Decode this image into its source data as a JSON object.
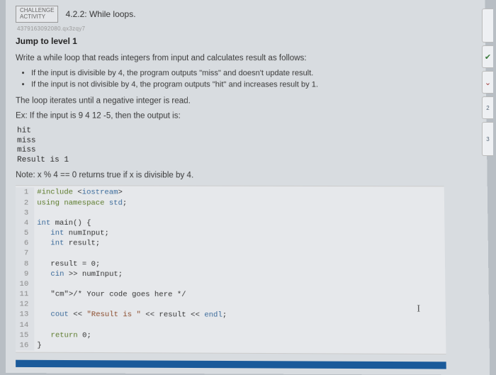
{
  "header": {
    "badge_line1": "CHALLENGE",
    "badge_line2": "ACTIVITY",
    "title": "4.2.2: While loops."
  },
  "meta_id": "4379163092080.qx3zqy7",
  "jump": "Jump to level 1",
  "intro": "Write a while loop that reads integers from input and calculates result as follows:",
  "bullets": [
    "If the input is divisible by 4, the program outputs \"miss\" and doesn't update result.",
    "If the input is not divisible by 4, the program outputs \"hit\" and increases result by 1."
  ],
  "loop_note": "The loop iterates until a negative integer is read.",
  "example_label": "Ex: If the input is 9 4 12 -5, then the output is:",
  "example_out": [
    "hit",
    "miss",
    "miss",
    "Result is 1"
  ],
  "note": "Note: x % 4 == 0 returns true if x is divisible by 4.",
  "code": [
    "#include <iostream>",
    "using namespace std;",
    "",
    "int main() {",
    "   int numInput;",
    "   int result;",
    "",
    "   result = 0;",
    "   cin >> numInput;",
    "",
    "   /* Your code goes here */",
    "",
    "   cout << \"Result is \" << result << endl;",
    "",
    "   return 0;",
    "}"
  ],
  "side": {
    "t2": "2",
    "t3": "3"
  }
}
